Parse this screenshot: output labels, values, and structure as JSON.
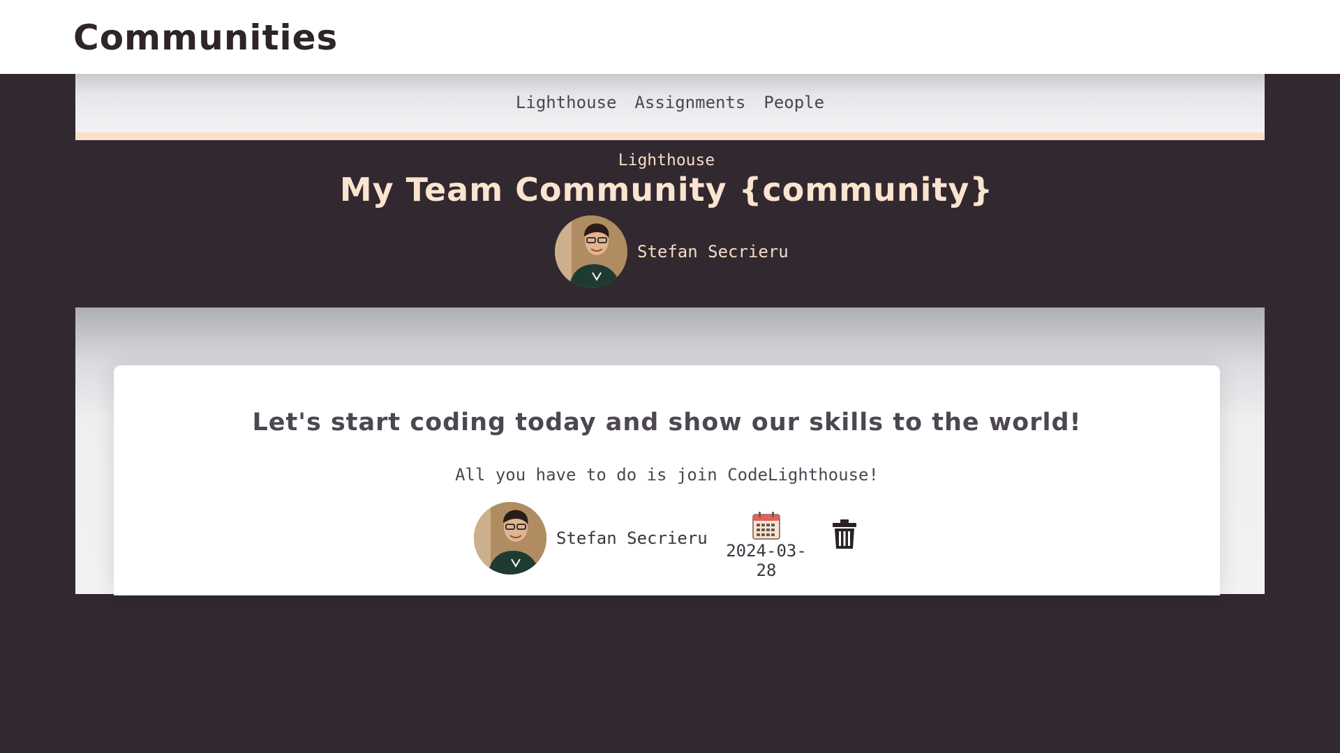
{
  "header": {
    "title": "Communities"
  },
  "nav": {
    "items": [
      {
        "label": "Lighthouse"
      },
      {
        "label": "Assignments"
      },
      {
        "label": "People"
      }
    ]
  },
  "hero": {
    "breadcrumb": "Lighthouse",
    "title": "My Team Community {community}",
    "owner_name": "Stefan Secrieru"
  },
  "post": {
    "title": "Let's start coding today and show our skills to the world!",
    "body": "All you have to do is join CodeLighthouse!",
    "author_name": "Stefan Secrieru",
    "date": "2024-03-28"
  },
  "colors": {
    "background": "#32282f",
    "accent": "#fbe0c8",
    "text_dark": "#3b3540"
  },
  "icons": {
    "calendar": "calendar-icon",
    "delete": "trash-icon"
  }
}
